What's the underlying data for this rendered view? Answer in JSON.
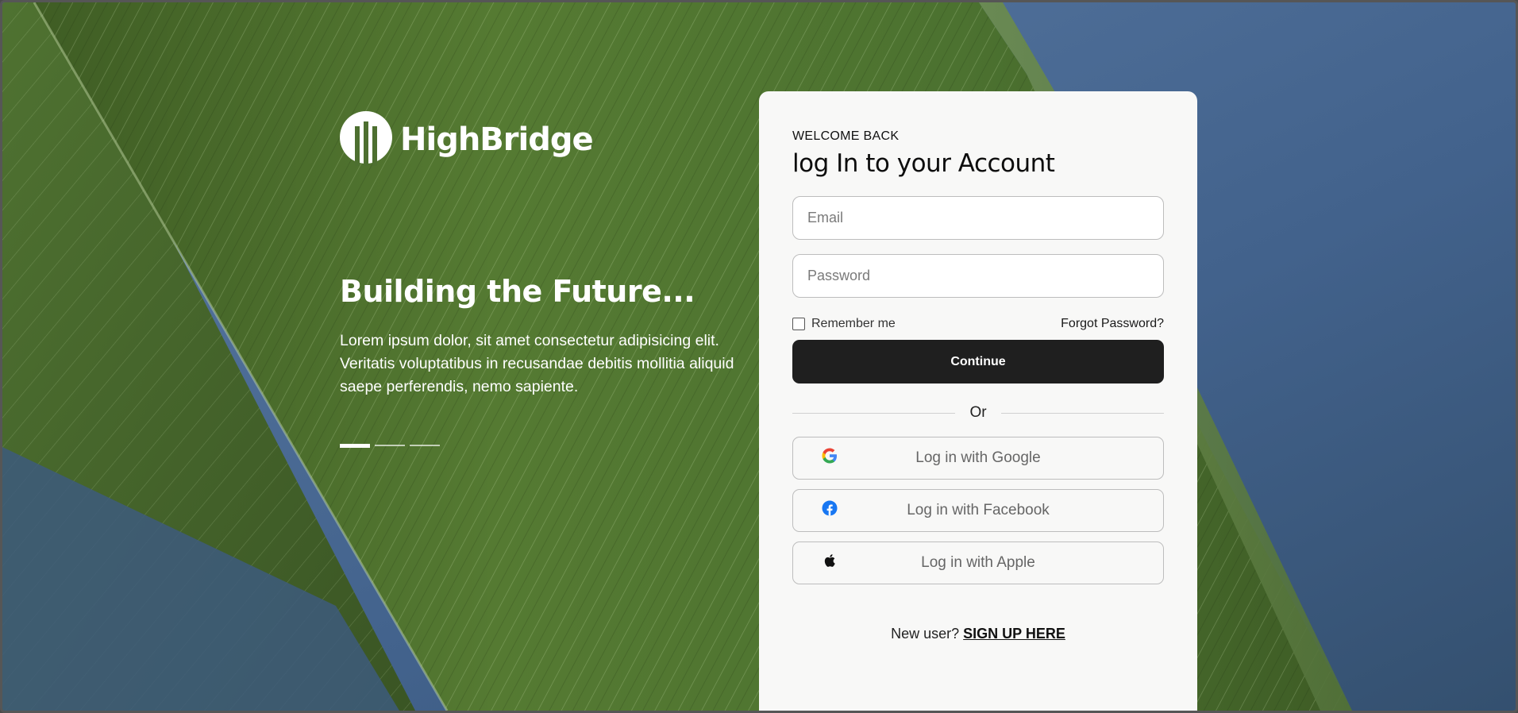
{
  "brand": {
    "name": "HighBridge"
  },
  "hero": {
    "headline": "Building the Future...",
    "body": "Lorem ipsum dolor, sit amet consectetur adipisicing elit. Veritatis voluptatibus in recusandae debitis mollitia aliquid saepe perferendis, nemo sapiente.",
    "slides": {
      "count": 3,
      "active_index": 0
    }
  },
  "login": {
    "eyebrow": "WELCOME BACK",
    "title": "log In to your Account",
    "email": {
      "value": "",
      "placeholder": "Email"
    },
    "password": {
      "value": "",
      "placeholder": "Password"
    },
    "remember_me": {
      "label": "Remember me",
      "checked": false
    },
    "forgot_password": "Forgot Password?",
    "continue_label": "Continue",
    "divider_label": "Or",
    "social": [
      {
        "label": "Log in with Google",
        "icon": "google-icon"
      },
      {
        "label": "Log in with Facebook",
        "icon": "facebook-icon"
      },
      {
        "label": "Log in with Apple",
        "icon": "apple-icon"
      }
    ],
    "signup_prompt": "New user?",
    "signup_link": "SIGN UP HERE"
  },
  "colors": {
    "primary_button": "#1f1f1f",
    "card_bg": "#f8f8f7",
    "sky": "#44648f",
    "leaf": "#5b7d35",
    "facebook": "#1877f2"
  }
}
